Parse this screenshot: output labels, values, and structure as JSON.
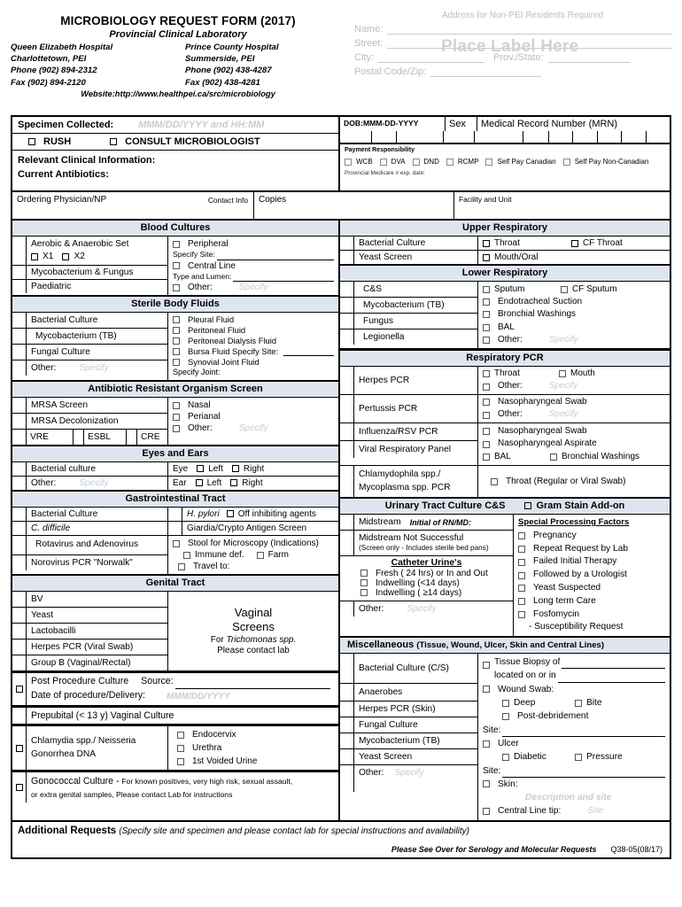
{
  "header": {
    "title": "MICROBIOLOGY REQUEST FORM (2017)",
    "subtitle": "Provincial Clinical Laboratory",
    "site1": {
      "name": "Queen Elizabeth Hospital",
      "city": "Charlottetown, PEI",
      "phone": "Phone (902) 894-2312",
      "fax": "Fax (902) 894-2120"
    },
    "site2": {
      "name": "Prince County Hospital",
      "city": "Summerside, PEI",
      "phone": "Phone (902) 438-4287",
      "fax": "Fax (902) 438-4281"
    },
    "website": "Website:http://www.healthpei.ca/src/microbiology"
  },
  "address": {
    "note": "Address for Non-PEI Residents Required",
    "name_label": "Name:",
    "street_label": "Street:",
    "city_label": "City:",
    "prov_label": "Prov./State:",
    "postal_label": "Postal Code/Zip:",
    "watermark": "Place Label Here"
  },
  "specimen": {
    "collected_label": "Specimen Collected:",
    "collected_placeholder": "MMM/DD/YYYY  and  HH:MM",
    "rush": "RUSH",
    "consult": "CONSULT MICROBIOLOGIST",
    "relevant": "Relevant Clinical Information:",
    "antibiotics": "Current Antibiotics:"
  },
  "patient": {
    "dob_label": "DOB:MMM-DD-YYYY",
    "sex_label": "Sex",
    "mrn_label": "Medical Record Number (MRN)",
    "payment_title": "Payment  Responsibility",
    "payment_options": [
      "WCB",
      "DVA",
      "DND",
      "RCMP",
      "Self Pay Canadian",
      "Self Pay Non-Canadian"
    ],
    "medicare_note": "Provincial Medicare # exp. date:"
  },
  "physician": {
    "ordering": "Ordering Physician/NP",
    "contact": "Contact Info",
    "copies": "Copies",
    "facility": "Facility and Unit"
  },
  "sections": {
    "blood_cultures": {
      "title": "Blood Cultures",
      "rows": [
        {
          "name": "Aerobic & Anaerobic Set",
          "sub": [
            "X1",
            "X2"
          ]
        },
        {
          "name": "Mycobacterium & Fungus"
        },
        {
          "name": "Paediatric"
        }
      ],
      "options": [
        "Peripheral",
        "Central Line",
        "Other:"
      ],
      "specify_site": "Specify Site:",
      "type_lumen": "Type and Lumen:",
      "specify": "Specify"
    },
    "sterile_body_fluids": {
      "title": "Sterile Body Fluids",
      "rows": [
        "Bacterial Culture",
        "Mycobacterium (TB)",
        "Fungal Culture"
      ],
      "other": "Other:",
      "specify": "Specify",
      "options": [
        "Pleural Fluid",
        "Peritoneal Fluid",
        "Peritoneal Dialysis Fluid",
        "Bursa Fluid Specify Site:",
        "Synovial Joint Fluid"
      ],
      "specify_joint": "Specify Joint:"
    },
    "aros": {
      "title": "Antibiotic Resistant Organism Screen",
      "rows": [
        "MRSA Screen",
        "MRSA Decolonization"
      ],
      "triple": [
        "VRE",
        "ESBL",
        "CRE"
      ],
      "options": [
        "Nasal",
        "Perianal",
        "Other:"
      ],
      "specify": "Specify"
    },
    "eyes_ears": {
      "title": "Eyes and Ears",
      "rows": [
        "Bacterial culture",
        "Other:"
      ],
      "specify": "Specify",
      "eye": "Eye",
      "ear": "Ear",
      "left": "Left",
      "right": "Right"
    },
    "gi_tract": {
      "title": "Gastrointestinal Tract",
      "left_rows": [
        "Bacterial Culture",
        "C. difficile",
        "Rotavirus and Adenovirus",
        "Norovirus PCR \"Norwalk\""
      ],
      "hpylori": "H. pylori",
      "off_inhibiting": "Off inhibiting agents",
      "giardia": "Giardia/Crypto Antigen Screen",
      "stool": "Stool for Microscopy (Indications)",
      "immune": "Immune def.",
      "farm": "Farm",
      "travel": "Travel to:"
    },
    "genital_tract": {
      "title": "Genital Tract",
      "rows": [
        "BV",
        "Yeast",
        "Lactobacilli",
        "Herpes PCR (Viral Swab)",
        "Group B (Vaginal/Rectal)"
      ],
      "vaginal_1": "Vaginal",
      "vaginal_2": "Screens",
      "vaginal_3a": "For ",
      "vaginal_3b": "Trichomonas spp.",
      "vaginal_4": "Please  contact lab",
      "post_procedure": "Post Procedure Culture",
      "source": "Source:",
      "date_proc": "Date of procedure/Delivery:",
      "date_placeholder": "MMM/DD/YYYY",
      "prepubital": "Prepubital (< 13 y) Vaginal Culture",
      "chlamydia_1": "Chlamydia spp./ Neisseria",
      "chlamydia_2": "Gonorrhea DNA",
      "chlamydia_opts": [
        "Endocervix",
        "Urethra",
        "1st Voided Urine"
      ],
      "gono_bold": "Gonococcal Culture -",
      "gono_1": "For known positives, very high risk, sexual assault,",
      "gono_2": "or extra genital samples, Please contact Lab for instructions"
    },
    "upper_resp": {
      "title": "Upper Respiratory",
      "rows": [
        "Bacterial Culture",
        "Yeast Screen"
      ],
      "opts_row1": [
        "Throat",
        "CF Throat"
      ],
      "opts_row2": [
        "Mouth/Oral"
      ]
    },
    "lower_resp": {
      "title": "Lower Respiratory",
      "rows": [
        "C&S",
        "Mycobacterium (TB)",
        "Fungus",
        "Legionella"
      ],
      "options": [
        "Sputum",
        "CF Sputum",
        "Endotracheal Suction",
        "Bronchial Washings",
        "BAL",
        "Other:"
      ],
      "specify": "Specify"
    },
    "resp_pcr": {
      "title": "Respiratory PCR",
      "herpes": "Herpes PCR",
      "herpes_opts": [
        "Throat",
        "Mouth",
        "Other:"
      ],
      "pertussis": "Pertussis PCR",
      "pertussis_opts": [
        "Nasopharyngeal Swab",
        "Other:"
      ],
      "influenza": "Influenza/RSV PCR",
      "viral_panel": "Viral Respiratory Panel",
      "flu_opts": [
        "Nasopharyngeal Swab",
        "Nasopharyngeal Aspirate",
        "BAL",
        "Bronchial Washings"
      ],
      "chlamydophila_1": "Chlamydophila spp./",
      "chlamydophila_2": "Mycoplasma spp. PCR",
      "chlam_opt": "Throat  (Regular or Viral Swab)",
      "specify": "Specify"
    },
    "urinary": {
      "title": "Urinary Tract Culture C&S",
      "gram_stain": "Gram Stain Add-on",
      "midstream": "Midstream",
      "initial": "Initial of RN/MD:",
      "not_successful": "Midstream Not Successful",
      "not_successful_sub": "(Screen only - Includes sterile bed pans)",
      "catheter_title": "Catheter Urine's",
      "catheter_opts": [
        "Fresh ( 24 hrs) or In and Out",
        "Indwelling (<14 days)",
        "Indwelling (  ≥14 days)"
      ],
      "other": "Other:",
      "specify": "Specify",
      "spf_title": "Special Processing Factors",
      "spf_opts": [
        "Pregnancy",
        "Repeat Request by Lab",
        "Failed Initial Therapy",
        "Followed by a Urologist",
        "Yeast Suspected",
        "Long term Care",
        "Fosfomycin"
      ],
      "spf_sub": "- Susceptibility Request"
    },
    "misc": {
      "title": "Miscellaneous",
      "title_sub": "(Tissue, Wound, Ulcer, Skin and Central Lines)",
      "rows": [
        "Bacterial Culture (C/S)",
        "Anaerobes",
        "Herpes PCR (Skin)",
        "Fungal Culture",
        "Mycobacterium (TB)",
        "Yeast Screen"
      ],
      "other": "Other:",
      "specify": "Specify",
      "tissue": "Tissue Biopsy of",
      "located": "located on or in",
      "wound": "Wound Swab:",
      "deep": "Deep",
      "bite": "Bite",
      "post_deb": "Post-debridement",
      "site": "Site:",
      "ulcer": "Ulcer",
      "diabetic": "Diabetic",
      "pressure": "Pressure",
      "skin": "Skin:",
      "skin_ghost": "Description and site",
      "central_line": "Central Line tip:",
      "central_ghost": "Site"
    }
  },
  "footer": {
    "additional_bold": "Additional Requests",
    "additional_italic": "(Specify site and specimen and please contact lab for special instructions and availability)",
    "see_over": "Please See Over for Serology and Molecular Requests",
    "form_code": "Q38-05(08/17)"
  }
}
